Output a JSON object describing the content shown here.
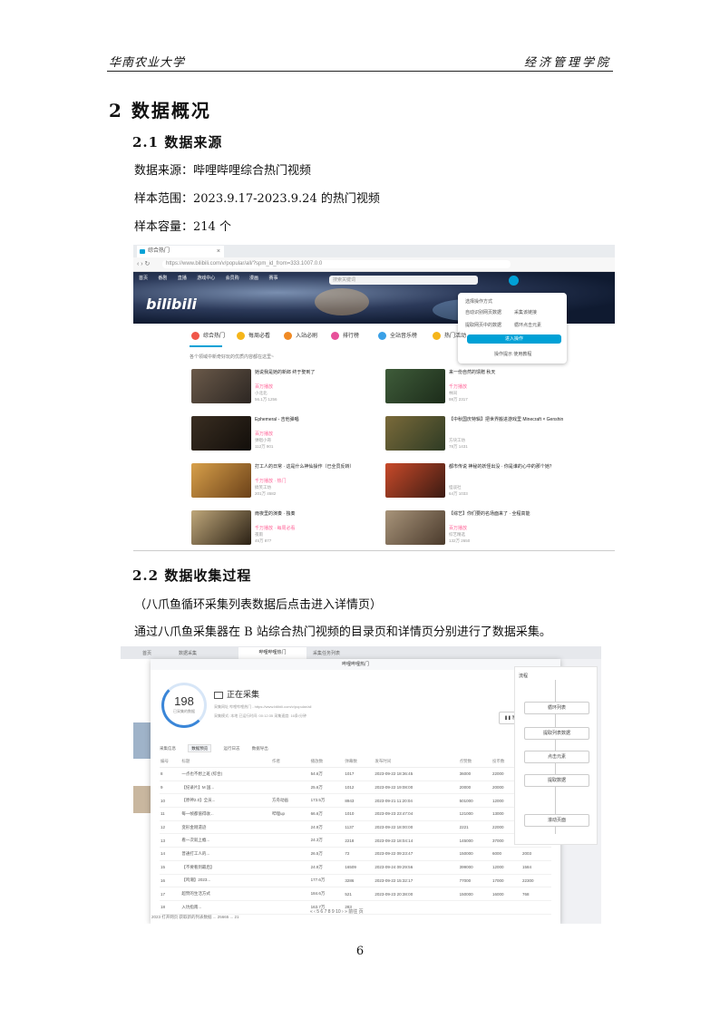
{
  "header": {
    "left": "华南农业大学",
    "right": "经济管理学院"
  },
  "section": {
    "num_title": "2 数据概况"
  },
  "sub1": {
    "title": "2.1 数据来源"
  },
  "lines": {
    "source": "数据来源：哔哩哔哩综合热门视频",
    "range": "样本范围：2023.9.17-2023.9.24 的热门视频",
    "size": "样本容量：214 个"
  },
  "sub2": {
    "title": "2.2 数据收集过程"
  },
  "caption": "（八爪鱼循环采集列表数据后点击进入详情页）",
  "desc": "通过八爪鱼采集器在 B 站综合热门视频的目录页和详情页分别进行了数据采集。",
  "page_number": "6",
  "screenshot1": {
    "tab_title": "综合热门",
    "tab_close": "×",
    "url": "https://www.bilibili.com/v/popular/all/?spm_id_from=333.1007.0.0",
    "nav_items": [
      "首页",
      "番剧",
      "直播",
      "游戏中心",
      "会员购",
      "漫画",
      "赛事"
    ],
    "search_placeholder": "搜索关键词",
    "logo": "bilibili",
    "popup": {
      "title": "选择操作方式",
      "options": [
        "自动识别网页数据",
        "采集该链接",
        "提取网页中的数据",
        "循环点击元素"
      ],
      "button": "进入操作",
      "link": "操作提示 使用教程"
    },
    "categories": [
      "综合热门",
      "每周必看",
      "入站必刷",
      "排行榜",
      "全站音乐榜",
      "热门活动"
    ],
    "subtitle": "各个领域中新奇好玩的优质内容都在这里~",
    "cards": [
      {
        "title": "她说我是她的新郎 终于娶到了",
        "tag": "百万播放",
        "up": "小北北",
        "stats": "56.1万  1256"
      },
      {
        "title": "来一份自然的馈赠 秋天",
        "tag": "千万播放",
        "up": "林间",
        "stats": "98万  2317"
      },
      {
        "title": "Ephemeral - 吉他弹唱",
        "tag": "百万播放",
        "up": "弹唱小哥",
        "stats": "112万  901"
      },
      {
        "title": "【中秋国庆特辑】把世界搬进游戏里 Minecraft × Genshin",
        "tag": "",
        "up": "方块工坊",
        "stats": "78万  1431"
      },
      {
        "title": "打工人的日常 · 这是什么神仙操作（已全员反转）",
        "tag": "千万播放 · 热门",
        "up": "搞笑工坊",
        "stats": "201万  4582"
      },
      {
        "title": "都市传说 神秘的妖怪出没 · 你是谁的心中的那个她？",
        "tag": "",
        "up": "怪谈社",
        "stats": "64万  1033"
      },
      {
        "title": "雨夜里的演奏 · 独奏",
        "tag": "千万播放 · 每周必看",
        "up": "夜雨",
        "stats": "45万  877"
      },
      {
        "title": "【综艺】你们要的名场面来了 · 全程高能",
        "tag": "百万播放",
        "up": "综艺精选",
        "stats": "132万  2650"
      }
    ]
  },
  "screenshot2": {
    "top_tabs": [
      "首页",
      "数据采集",
      "哔哩哔哩热门",
      "采集任务列表"
    ],
    "active_tab": "哔哩哔哩热门",
    "modal_title": "哔哩哔哩热门",
    "count": "198",
    "count_label": "已采集的数据",
    "status": "正在采集",
    "url_line": "采集网址  哔哩哔哩热门 - https://www.bilibili.com/v/popular/all",
    "meta_line": "采集模式: 本地    已运行时间: 00:12:35    采集速度: 16条/分钟",
    "pause_label": "暂停",
    "tabs": [
      "采集信息",
      "数据预览",
      "运行日志",
      "数据导出"
    ],
    "columns": [
      "编号",
      "标题",
      "作者",
      "播放数",
      "弹幕数",
      "发布时间",
      "点赞数",
      "投币数",
      "收藏数"
    ],
    "rows": [
      [
        "8",
        "一点也不想上班 (综合)",
        "",
        "54.6万",
        "1017",
        "2023-09-22 18:36:45",
        "36000",
        "22000",
        "8484"
      ],
      [
        "9",
        "【纪录片】M 国...",
        "",
        "25.6万",
        "1012",
        "2023-09-22 19:08:00",
        "20000",
        "20000",
        "7797"
      ],
      [
        "10",
        "【原神2.0】全员...",
        "方舟动画",
        "173.5万",
        "8943",
        "2023-09-21 11:20:04",
        "501000",
        "12000",
        "2469"
      ],
      [
        "11",
        "每一帧都值得收...",
        "哔哩up",
        "66.6万",
        "1010",
        "2023-09-23 23:47:04",
        "121000",
        "13000",
        "20000"
      ],
      [
        "12",
        "变形金刚遗迹",
        "",
        "24.9万",
        "1137",
        "2023-09-22 18:00:00",
        "2221",
        "22000",
        "2963"
      ],
      [
        "13",
        "看一次就上瘾...",
        "",
        "24.3万",
        "2218",
        "2023-09-22 18:04:14",
        "145000",
        "37000",
        "826"
      ],
      [
        "14",
        "普通打工人的...",
        "",
        "26.5万",
        "72",
        "2023-09-22 09:23:47",
        "150000",
        "6000",
        "2003"
      ],
      [
        "15",
        "【不要看到最后】",
        "",
        "24.9万",
        "16509",
        "2023-09-24 09:29:56",
        "399000",
        "12000",
        "1584"
      ],
      [
        "16",
        "【鸣潮】2023...",
        "",
        "177.6万",
        "3286",
        "2023-09-22 15:32:17",
        "77000",
        "17000",
        "22300"
      ],
      [
        "17",
        "超赞的生活方式",
        "",
        "184.6万",
        "521",
        "2023-09-23 20:38:00",
        "150000",
        "16000",
        "768"
      ],
      [
        "18",
        "入坑指南...",
        "",
        "163.7万",
        "283",
        "",
        "",
        "",
        ""
      ]
    ],
    "pager": "«  ‹  5  6  7  8  9  10  ›   »    前往  页",
    "flow_title": "流程",
    "flow_nodes": [
      "循环列表",
      "提取列表数据",
      "点击元素",
      "提取数据",
      "滚动页面"
    ],
    "footer_row": "2023 打开网页 获取新的列表数据 ...  25665  ...  21"
  }
}
